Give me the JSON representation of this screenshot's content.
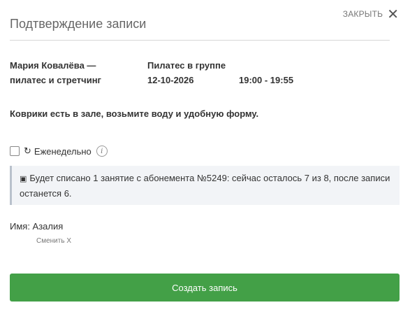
{
  "dialog": {
    "close_label": "ЗАКРЫТЬ",
    "close_icon": "✕",
    "title": "Подтверждение записи"
  },
  "booking": {
    "trainer_line1": "Мария Ковалёва —",
    "trainer_line2": "пилатес и стретчинг",
    "class_name": "Пилатес в группе",
    "date": "12-10-2026",
    "time": "19:00 - 19:55"
  },
  "notice": "Коврики есть в зале, возьмите воду и удобную форму.",
  "weekly": {
    "checked": false,
    "repeat_icon": "↻",
    "label": "Еженедельно",
    "info_icon": "i"
  },
  "alert": {
    "icon": "▣",
    "text": "Будет списано 1 занятие с абонемента №5249: сейчас осталось 7 из 8, после записи останется 6."
  },
  "client": {
    "name_label": "Имя: Азалия",
    "change_label": "Сменить X"
  },
  "actions": {
    "submit_label": "Создать запись"
  },
  "colors": {
    "accent": "#43a047",
    "alert_bg": "#f2f4f7",
    "alert_border": "#b9c1cc"
  }
}
